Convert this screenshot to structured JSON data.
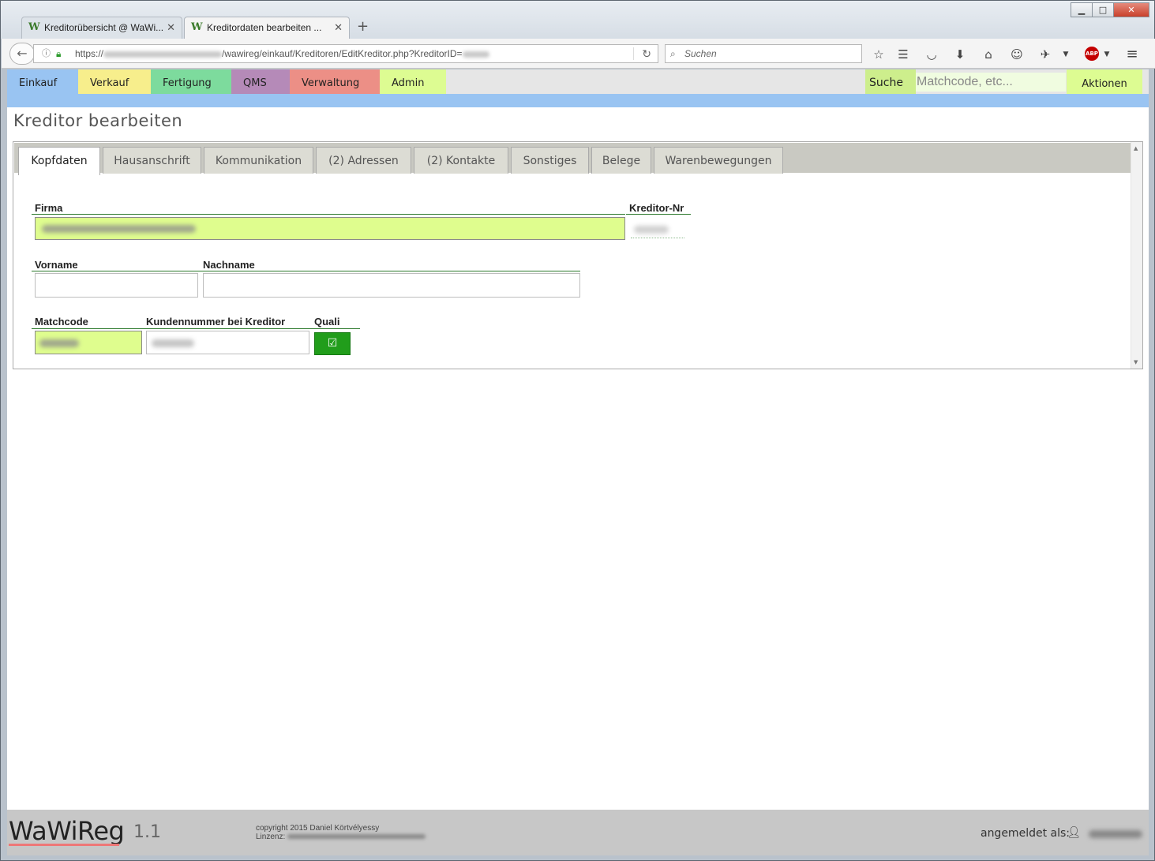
{
  "browser": {
    "tabs": [
      {
        "label": "Kreditorübersicht @ WaWi...",
        "favicon": "W",
        "active": false
      },
      {
        "label": "Kreditordaten bearbeiten ...",
        "favicon": "W",
        "active": true
      }
    ],
    "new_tab_label": "+",
    "tab_close_label": "✕",
    "url_prefix": "https://",
    "url_path": "/wawireg/einkauf/Kreditoren/EditKreditor.php?KreditorID=",
    "search_placeholder": "Suchen",
    "window_controls": {
      "minimize": "▁",
      "maximize": "□",
      "close": "✕"
    }
  },
  "app_menu": {
    "items": [
      {
        "label": "Einkauf",
        "color": "#99c4f2"
      },
      {
        "label": "Verkauf",
        "color": "#f7ee8c"
      },
      {
        "label": "Fertigung",
        "color": "#7ddb9d"
      },
      {
        "label": "QMS",
        "color": "#b58ab8"
      },
      {
        "label": "Verwaltung",
        "color": "#ec8f86"
      },
      {
        "label": "Admin",
        "color": "#ddfc92"
      }
    ],
    "search_label": "Suche",
    "search_placeholder": "Matchcode, etc...",
    "actions_label": "Aktionen"
  },
  "page": {
    "title": "Kreditor bearbeiten",
    "tabs": [
      "Kopfdaten",
      "Hausanschrift",
      "Kommunikation",
      "(2) Adressen",
      "(2) Kontakte",
      "Sonstiges",
      "Belege",
      "Warenbewegungen"
    ],
    "active_tab": "Kopfdaten"
  },
  "form": {
    "firma_label": "Firma",
    "kreditor_nr_label": "Kreditor-Nr",
    "vorname_label": "Vorname",
    "vorname_value": "",
    "nachname_label": "Nachname",
    "nachname_value": "",
    "matchcode_label": "Matchcode",
    "kundennummer_label": "Kundennummer bei Kreditor",
    "quali_label": "Quali",
    "quali_checked": true
  },
  "footer": {
    "logo": "WaWiReg",
    "version": "1.1",
    "copyright": "copyright 2015 Daniel Körtvélyessy",
    "license_label": "Linzenz:",
    "logged_in_label": "angemeldet als:"
  },
  "colors": {
    "accent_green_field": "#dffd8e",
    "quali_button": "#219d1b",
    "label_underline": "#2d7a2d"
  }
}
